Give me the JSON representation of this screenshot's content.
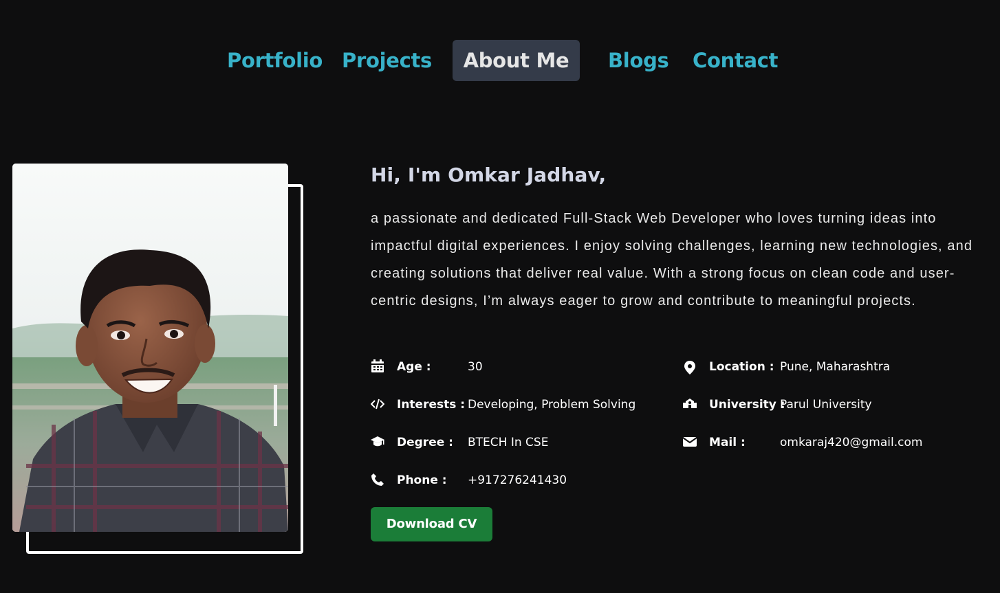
{
  "nav": {
    "items": [
      {
        "label": "Portfolio",
        "active": false
      },
      {
        "label": "Projects",
        "active": false
      },
      {
        "label": "About Me",
        "active": true
      },
      {
        "label": "Blogs",
        "active": false
      },
      {
        "label": "Contact",
        "active": false
      }
    ]
  },
  "about": {
    "greeting": "Hi, I'm Omkar Jadhav,",
    "bio": "a passionate and dedicated Full-Stack Web Developer who loves turning ideas into impactful digital experiences. I enjoy solving challenges, learning new technologies, and creating solutions that deliver real value. With a strong focus on clean code and user-centric designs, I’m always eager to grow and contribute to meaningful projects.",
    "info": {
      "age": {
        "icon": "calendar-icon",
        "label": "Age :",
        "value": "30"
      },
      "interests": {
        "icon": "code-icon",
        "label": "Interests :",
        "value": "Developing, Problem Solving"
      },
      "degree": {
        "icon": "graduation-cap-icon",
        "label": "Degree :",
        "value": "BTECH In CSE"
      },
      "phone": {
        "icon": "phone-icon",
        "label": "Phone :",
        "value": "+917276241430"
      },
      "location": {
        "icon": "map-pin-icon",
        "label": "Location :",
        "value": "Pune, Maharashtra"
      },
      "university": {
        "icon": "school-icon",
        "label": "University :",
        "value": "Parul University"
      },
      "mail": {
        "icon": "envelope-icon",
        "label": "Mail :",
        "value": "omkaraj420@gmail.com"
      }
    },
    "download_cv_label": "Download CV"
  },
  "colors": {
    "background": "#0e0e0f",
    "nav_link": "#38b2c9",
    "nav_active_bg": "#343b49",
    "button_green": "#1b7d38"
  }
}
